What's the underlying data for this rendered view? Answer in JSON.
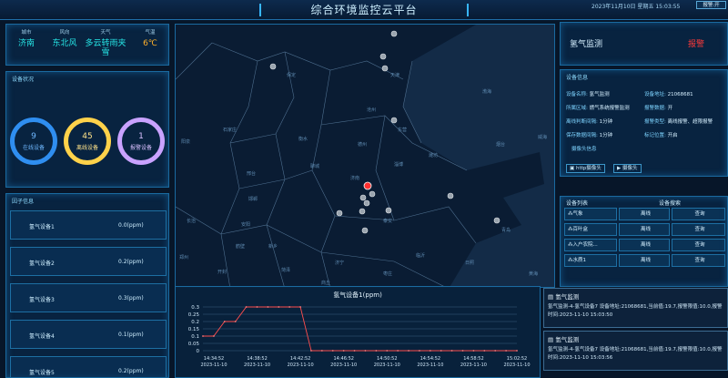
{
  "header": {
    "title": "综合环境监控云平台",
    "datetime": "2023年11月10日 星期五 15:03:55",
    "alarm_toggle": "报警:开"
  },
  "weather": {
    "heads": [
      "城市",
      "风向",
      "天气",
      "气温"
    ],
    "values": [
      "济南",
      "东北风",
      "多云转雨夹雪",
      "6℃"
    ]
  },
  "device_status": {
    "title": "设备状况",
    "items": [
      {
        "num": "9",
        "label": "在线设备",
        "color": "#2f8ef0"
      },
      {
        "num": "45",
        "label": "离线设备",
        "color": "#ffd24a"
      },
      {
        "num": "1",
        "label": "报警设备",
        "color": "#c9a2ff"
      }
    ]
  },
  "gas_list": {
    "title": "因子信息",
    "items": [
      {
        "name": "氢气设备1",
        "value": "0.0(ppm)"
      },
      {
        "name": "氢气设备2",
        "value": "0.2(ppm)"
      },
      {
        "name": "氢气设备3",
        "value": "0.3(ppm)"
      },
      {
        "name": "氢气设备4",
        "value": "0.1(ppm)"
      },
      {
        "name": "氢气设备5",
        "value": "0.2(ppm)"
      }
    ]
  },
  "map": {
    "labels": [
      "保定",
      "天津",
      "沧州",
      "石家庄",
      "衡水",
      "德州",
      "阳泉",
      "邢台",
      "聊城",
      "东营",
      "潍坊",
      "济南",
      "淄博",
      "邯郸",
      "泰安",
      "长治",
      "安阳",
      "临沂",
      "鹤壁",
      "新乡",
      "济宁",
      "菏泽",
      "商丘",
      "日照",
      "青岛",
      "渤海",
      "黄海",
      "烟台",
      "威海",
      "开封",
      "郑州",
      "枣庄"
    ]
  },
  "chart": {
    "title": "氢气设备1(ppm)"
  },
  "chart_data": {
    "type": "line",
    "title": "氢气设备1(ppm)",
    "x_labels": [
      "14:34:52\n2023-11-10",
      "14:38:52\n2023-11-10",
      "14:42:52\n2023-11-10",
      "14:46:52\n2023-11-10",
      "14:50:52\n2023-11-10",
      "14:54:52\n2023-11-10",
      "14:58:52\n2023-11-10",
      "15:02:52\n2023-11-10"
    ],
    "yticks": [
      "0.3",
      "0.25",
      "0.2",
      "0.15",
      "0.1",
      "0.05",
      "0"
    ],
    "ylim": [
      0,
      0.3
    ],
    "values": [
      0.1,
      0.1,
      0.2,
      0.2,
      0.3,
      0.3,
      0.3,
      0.3,
      0.3,
      0.3,
      0.0,
      0.0,
      0.0,
      0.0,
      0.0,
      0.0,
      0.0,
      0.0,
      0.0,
      0.0,
      0.0,
      0.0,
      0.0,
      0.0,
      0.0,
      0.0,
      0.0,
      0.0,
      0.0,
      0.0
    ]
  },
  "gas_monitor": {
    "title": "氢气监测",
    "alarm": "报警"
  },
  "device_info": {
    "title": "设备信息",
    "rows": [
      [
        "设备名称: ",
        "氢气监测",
        "设备地址: ",
        "21068681"
      ],
      [
        "所属区域: ",
        "燃气系统报警监测",
        "报警数据: ",
        "开"
      ],
      [
        "离线判断间隔: ",
        "1分钟",
        "报警类型: ",
        "离线报警、超限报警"
      ],
      [
        "保存数据间隔: ",
        "1分钟",
        "标记位置: ",
        "开启"
      ]
    ],
    "camera_label": "摄像头信息",
    "buttons": [
      "http摄像头",
      "摄像头"
    ]
  },
  "device_table": {
    "tabs": [
      "设备列表",
      "设备搜索"
    ],
    "rows": [
      {
        "name": "气象",
        "status": "离线",
        "action": "查询"
      },
      {
        "name": "百叶盒",
        "status": "离线",
        "action": "查询"
      },
      {
        "name": "入户农院...",
        "status": "离线",
        "action": "查询"
      },
      {
        "name": "水质1",
        "status": "离线",
        "action": "查询"
      }
    ]
  },
  "alerts": [
    {
      "title": "氢气监测",
      "body": "氢气监测-4-氢气设备7 设备地址:21068681,当前值:19.7,报警限值:10.0,报警时间:2023-11-10 15:03:50"
    },
    {
      "title": "氢气监测",
      "body": "氢气监测-4-氢气设备7 设备地址:21068681,当前值:19.7,报警限值:10.0,报警时间:2023-11-10 15:03:56"
    }
  ]
}
